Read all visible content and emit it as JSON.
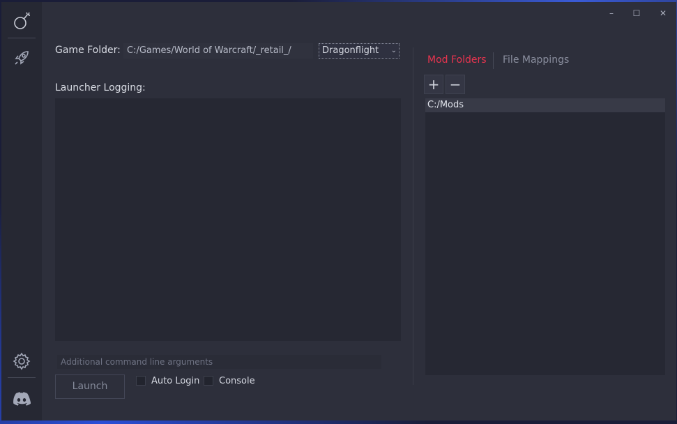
{
  "window": {
    "controls": {
      "minimize": "–",
      "maximize": "☐",
      "close": "✕"
    }
  },
  "sidebar": {
    "items": [
      {
        "name": "mods",
        "icon": "bomb-icon"
      },
      {
        "name": "launcher",
        "icon": "rocket-icon"
      },
      {
        "name": "settings",
        "icon": "gear-icon"
      },
      {
        "name": "discord",
        "icon": "discord-icon"
      }
    ]
  },
  "left_panel": {
    "game_folder_label": "Game Folder:",
    "game_folder_value": "C:/Games/World of Warcraft/_retail_/",
    "flavor_selected": "Dragonflight",
    "logging_label": "Launcher Logging:",
    "args_placeholder": "Additional command line arguments",
    "launch_label": "Launch",
    "auto_login_label": "Auto Login",
    "console_label": "Console"
  },
  "right_panel": {
    "tabs": [
      {
        "label": "Mod Folders",
        "active": true
      },
      {
        "label": "File Mappings",
        "active": false
      }
    ],
    "add_label": "+",
    "remove_label": "−",
    "mod_folders": [
      "C:/Mods"
    ]
  },
  "colors": {
    "accent": "#e8344f",
    "window_bg": "#2d2f3b",
    "sidebar_bg": "#262833",
    "inactive_tab": "#8a8e9e"
  }
}
